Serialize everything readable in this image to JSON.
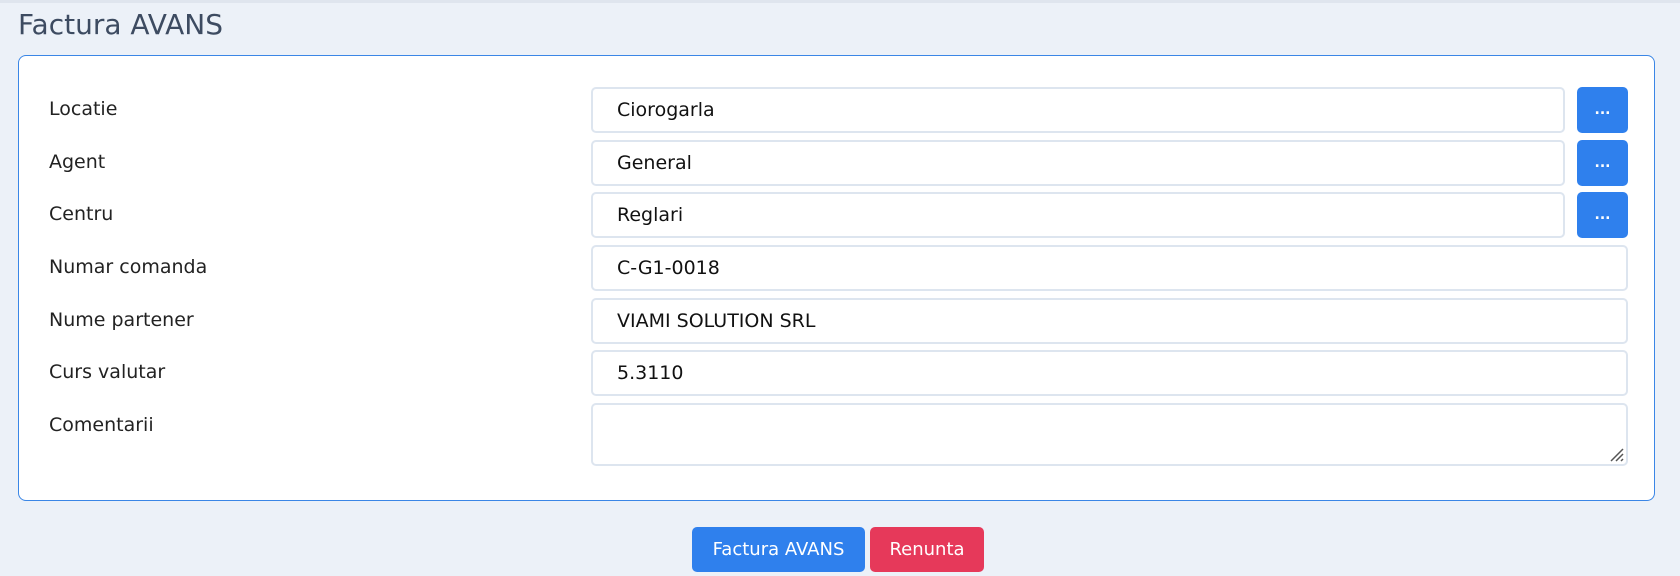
{
  "page": {
    "title": "Factura AVANS"
  },
  "form": {
    "fields": [
      {
        "label": "Locatie",
        "value": "Ciorogarla",
        "button": "..."
      },
      {
        "label": "Agent",
        "value": "General",
        "button": "..."
      },
      {
        "label": "Centru",
        "value": "Reglari",
        "button": "..."
      },
      {
        "label": "Numar comanda",
        "value": "C-G1-0018"
      },
      {
        "label": "Nume partener",
        "value": "VIAMI SOLUTION SRL"
      },
      {
        "label": "Curs valutar",
        "value": "5.3110"
      },
      {
        "label": "Comentarii",
        "value": ""
      }
    ]
  },
  "actions": {
    "submit_label": "Factura AVANS",
    "cancel_label": "Renunta"
  },
  "colors": {
    "accent": "#2f80ed",
    "danger": "#e6395a",
    "background": "#ecf1f8",
    "panel_border": "#3a86e6"
  },
  "icons": {
    "resize_grip": "resize-grip-icon"
  }
}
